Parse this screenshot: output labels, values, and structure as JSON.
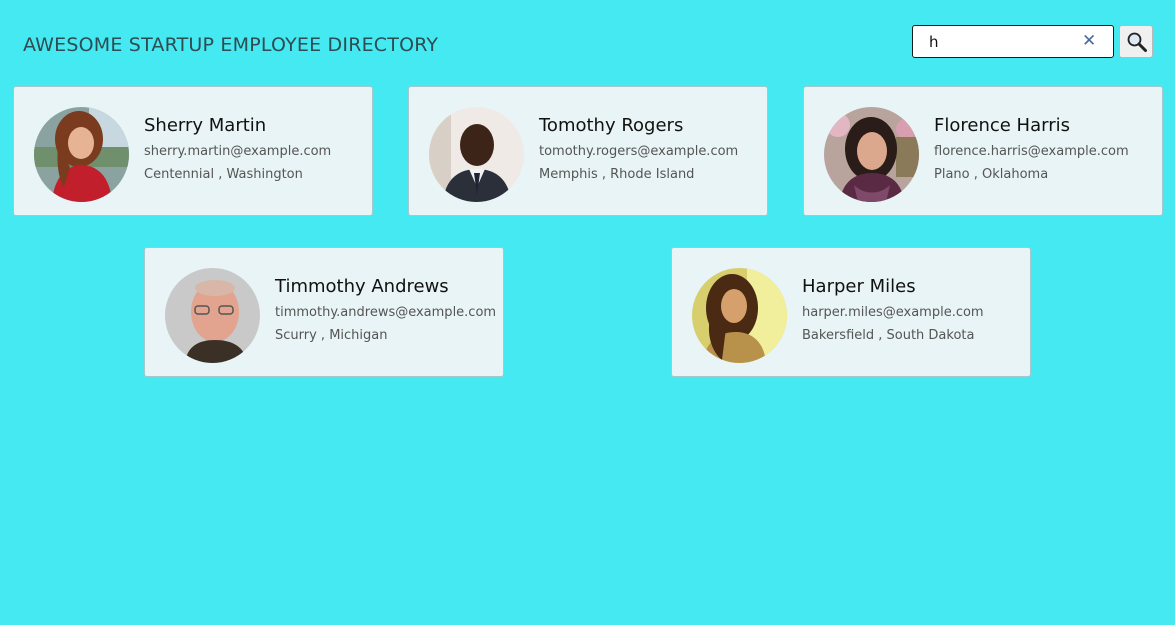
{
  "header": {
    "title": "AWESOME STARTUP EMPLOYEE DIRECTORY"
  },
  "search": {
    "value": "h",
    "placeholder": "",
    "clear_icon": "clear-icon",
    "button_icon": "search-icon"
  },
  "employees": [
    {
      "name": "Sherry Martin",
      "email": "sherry.martin@example.com",
      "location": "Centennial , Washington"
    },
    {
      "name": "Tomothy Rogers",
      "email": "tomothy.rogers@example.com",
      "location": "Memphis , Rhode Island"
    },
    {
      "name": "Florence Harris",
      "email": "florence.harris@example.com",
      "location": "Plano , Oklahoma"
    },
    {
      "name": "Timmothy Andrews",
      "email": "timmothy.andrews@example.com",
      "location": "Scurry , Michigan"
    },
    {
      "name": "Harper Miles",
      "email": "harper.miles@example.com",
      "location": "Bakersfield , South Dakota"
    }
  ],
  "colors": {
    "background": "#44e9f1",
    "card": "#e8f4f6",
    "title": "#2f4c52"
  }
}
